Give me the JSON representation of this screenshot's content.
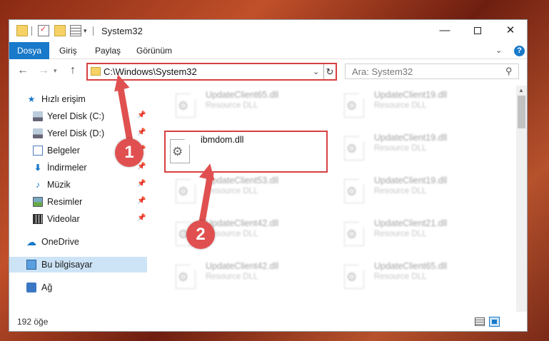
{
  "window": {
    "title": "System32",
    "minimize": "—",
    "close": "✕"
  },
  "ribbon": {
    "tabs": [
      "Dosya",
      "Giriş",
      "Paylaş",
      "Görünüm"
    ],
    "expand": "⌄",
    "help": "?"
  },
  "navigation": {
    "back": "←",
    "forward": "→",
    "up": "↑",
    "address": "C:\\Windows\\System32",
    "search_placeholder": "Ara: System32"
  },
  "sidebar": {
    "items": [
      {
        "label": "Hızlı erişim",
        "icon": "star-icon",
        "pinned": false
      },
      {
        "label": "Yerel Disk (C:)",
        "icon": "drive-icon",
        "pinned": true
      },
      {
        "label": "Yerel Disk (D:)",
        "icon": "drive-icon",
        "pinned": true
      },
      {
        "label": "Belgeler",
        "icon": "documents-icon",
        "pinned": true
      },
      {
        "label": "İndirmeler",
        "icon": "downloads-icon",
        "pinned": true
      },
      {
        "label": "Müzik",
        "icon": "music-icon",
        "pinned": true
      },
      {
        "label": "Resimler",
        "icon": "pictures-icon",
        "pinned": true
      },
      {
        "label": "Videolar",
        "icon": "videos-icon",
        "pinned": true
      },
      {
        "label": "OneDrive",
        "icon": "onedrive-icon",
        "pinned": false
      },
      {
        "label": "Bu bilgisayar",
        "icon": "this-pc-icon",
        "pinned": false,
        "selected": true
      },
      {
        "label": "Ağ",
        "icon": "network-icon",
        "pinned": false
      }
    ]
  },
  "files": [
    {
      "name": "UpdateClient65.dll",
      "type": "Resource DLL"
    },
    {
      "name": "UpdateClient19.dll",
      "type": "Resource DLL"
    },
    {
      "name": "ibmdom.dll",
      "type": ""
    },
    {
      "name": "UpdateClient19.dll",
      "type": "Resource DLL"
    },
    {
      "name": "UpdateClient53.dll",
      "type": "Resource DLL"
    },
    {
      "name": "UpdateClient19.dll",
      "type": "Resource DLL"
    },
    {
      "name": "UpdateClient42.dll",
      "type": "Resource DLL"
    },
    {
      "name": "UpdateClient21.dll",
      "type": "Resource DLL"
    },
    {
      "name": "UpdateClient42.dll",
      "type": "Resource DLL"
    },
    {
      "name": "UpdateClient65.dll",
      "type": "Resource DLL"
    }
  ],
  "status": {
    "item_count": "192 öğe"
  },
  "callouts": [
    "1",
    "2"
  ],
  "colors": {
    "accent": "#1979ca",
    "highlight": "#d74040",
    "selection": "#cde4f7"
  }
}
